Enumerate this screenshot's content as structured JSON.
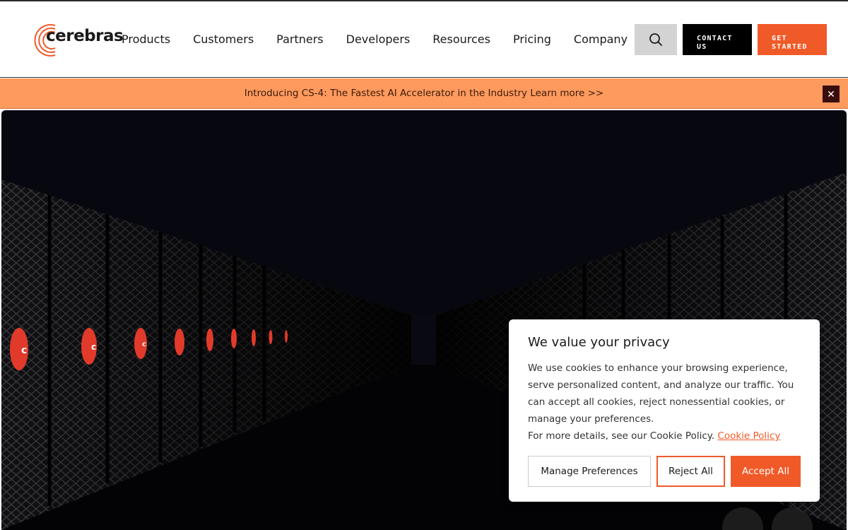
{
  "brand": {
    "name": "cerebras",
    "accent": "#f05a28"
  },
  "nav": {
    "items": [
      {
        "label": "Products"
      },
      {
        "label": "Customers"
      },
      {
        "label": "Partners"
      },
      {
        "label": "Developers"
      },
      {
        "label": "Resources"
      },
      {
        "label": "Pricing"
      },
      {
        "label": "Company"
      }
    ],
    "search_icon": "search-icon",
    "contact_label_line1": "CONTACT",
    "contact_label_line2": "US",
    "started_label_line1": "GET",
    "started_label_line2": "STARTED"
  },
  "banner": {
    "text": "Introducing CS-4: The Fastest AI Accelerator in the Industry Learn more >>",
    "close_icon": "close-icon",
    "close_glyph": "✕"
  },
  "cookie": {
    "title": "We value your privacy",
    "body": "We use cookies to enhance your browsing experience, serve personalized content, and analyze our traffic. You can accept all cookies, reject nonessential cookies, or manage your preferences.",
    "more_prefix": "For more details, see our Cookie Policy.",
    "link_label": "Cookie Policy",
    "manage_label": "Manage Preferences",
    "reject_label": "Reject All",
    "accept_label": "Accept All"
  }
}
